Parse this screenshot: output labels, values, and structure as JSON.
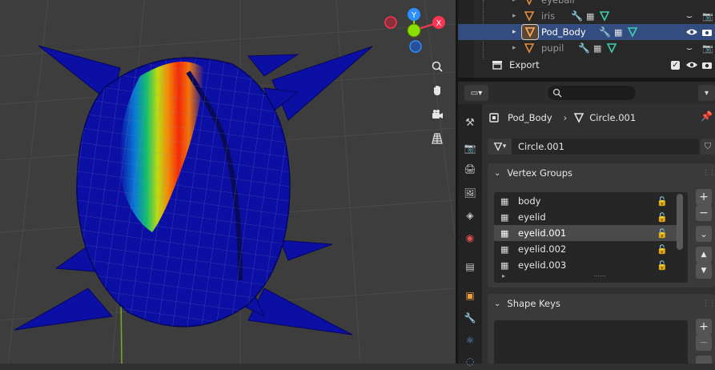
{
  "outliner": {
    "rows": [
      {
        "label": "eyeball",
        "visible": true
      },
      {
        "label": "iris",
        "visible": false
      },
      {
        "label": "Pod_Body",
        "visible": true,
        "selected": true
      },
      {
        "label": "pupil",
        "visible": false
      }
    ],
    "export_label": "Export"
  },
  "properties": {
    "search_placeholder": "",
    "breadcrumb_object": "Pod_Body",
    "breadcrumb_mesh": "Circle.001",
    "mesh_name": "Circle.001",
    "vertex_groups_title": "Vertex Groups",
    "vertex_groups": [
      "body",
      "eyelid",
      "eyelid.001",
      "eyelid.002",
      "eyelid.003"
    ],
    "selected_group_index": 2,
    "shape_keys_title": "Shape Keys"
  },
  "colors": {
    "selection": "#334d80",
    "mesh_blue": "#0b0fa3",
    "weight_red": "#ff2b00",
    "axis_x": "#ff3352",
    "axis_y": "#8bdc00",
    "axis_z": "#2c8fff"
  },
  "icons": [
    "search-icon",
    "zoom-icon",
    "hand-icon",
    "camera-icon",
    "grid-icon",
    "eye-icon",
    "camera-render-icon",
    "wrench-icon",
    "mesh-icon",
    "pin-icon",
    "lock-icon",
    "plus-icon",
    "minus-icon",
    "chevron-down-icon",
    "arrow-up-icon",
    "arrow-down-icon"
  ]
}
